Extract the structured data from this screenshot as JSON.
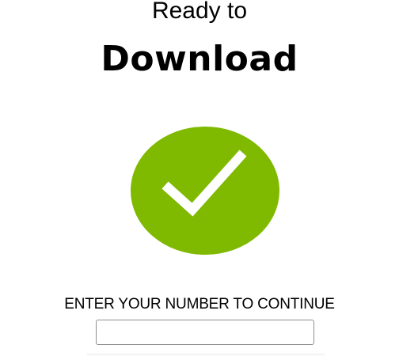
{
  "header": {
    "line1": "Ready to",
    "line2": "Download"
  },
  "status": {
    "icon": "checkmark-circle-icon",
    "accent_color": "#7fba00"
  },
  "form": {
    "prompt": "ENTER YOUR NUMBER TO CONTINUE",
    "number_value": "",
    "number_placeholder": ""
  }
}
